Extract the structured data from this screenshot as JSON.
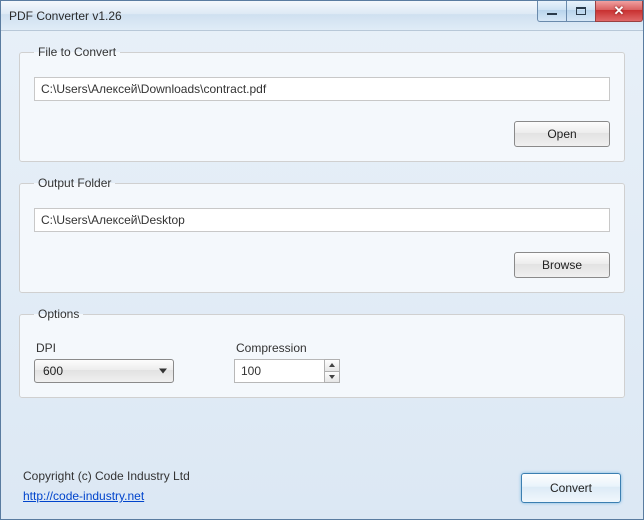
{
  "window": {
    "title": "PDF Converter v1.26"
  },
  "fileToConvert": {
    "legend": "File to Convert",
    "path": "C:\\Users\\Алексей\\Downloads\\contract.pdf",
    "openLabel": "Open"
  },
  "outputFolder": {
    "legend": "Output Folder",
    "path": "C:\\Users\\Алексей\\Desktop",
    "browseLabel": "Browse"
  },
  "options": {
    "legend": "Options",
    "dpi": {
      "label": "DPI",
      "value": "600"
    },
    "compression": {
      "label": "Compression",
      "value": "100"
    }
  },
  "footer": {
    "copyright": "Copyright (c) Code Industry Ltd",
    "link": "http://code-industry.net",
    "convertLabel": "Convert"
  }
}
